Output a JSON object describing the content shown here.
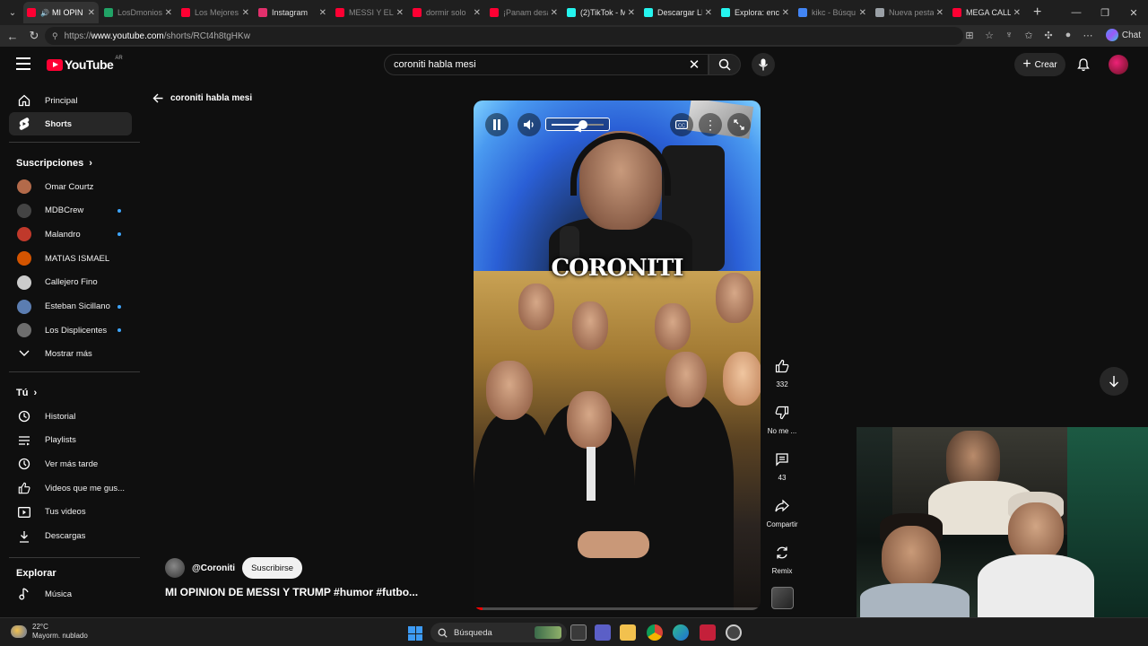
{
  "browser": {
    "tabs": [
      {
        "title": "MI OPIN",
        "active": true,
        "color": "#ff0033",
        "sound": true
      },
      {
        "title": "LosDmonios",
        "color": "#21a366"
      },
      {
        "title": "Los Mejores",
        "color": "#ff0033"
      },
      {
        "title": "Instagram",
        "color": "#e1306c",
        "lit": true
      },
      {
        "title": "MESSI Y EL",
        "color": "#ff0033"
      },
      {
        "title": "dormir solo",
        "color": "#ff0033"
      },
      {
        "title": "¡Panam desa",
        "color": "#ff0033"
      },
      {
        "title": "(2)TikTok - M",
        "color": "#25f4ee",
        "lit": true
      },
      {
        "title": "Descargar LIV",
        "color": "#25f4ee",
        "lit": true
      },
      {
        "title": "Explora: encu",
        "color": "#25f4ee",
        "lit": true
      },
      {
        "title": "kikc - Búsqu",
        "color": "#4285f4"
      },
      {
        "title": "Nueva pesta",
        "color": "#9aa0a6"
      },
      {
        "title": "MEGA CALLE",
        "color": "#ff0033",
        "lit": true
      }
    ],
    "url_prefix": "https://",
    "url_host": "www.youtube.com",
    "url_path": "/shorts/RCt4h8tgHKw",
    "chat_label": "Chat"
  },
  "header": {
    "logo_text": "YouTube",
    "country_code": "AR",
    "search_value": "coroniti habla mesi",
    "create_label": "Crear"
  },
  "sidebar": {
    "main": [
      {
        "label": "Principal",
        "icon": "home-icon"
      },
      {
        "label": "Shorts",
        "icon": "shorts-icon",
        "selected": true
      }
    ],
    "subscriptions_title": "Suscripciones",
    "subscriptions": [
      {
        "label": "Omar Courtz",
        "color": "#b36a4a"
      },
      {
        "label": "MDBCrew",
        "color": "#444444",
        "dot": true
      },
      {
        "label": "Malandro",
        "color": "#c0392b",
        "dot": true
      },
      {
        "label": "MATIAS ISMAEL",
        "color": "#d35400"
      },
      {
        "label": "Callejero Fino",
        "color": "#cccccc"
      },
      {
        "label": "Esteban Sicillano",
        "color": "#5b7db1",
        "dot": true
      },
      {
        "label": "Los Displicentes",
        "color": "#6d6d6d",
        "dot": true
      }
    ],
    "show_more": "Mostrar más",
    "you_title": "Tú",
    "you": [
      {
        "label": "Historial",
        "icon": "history-icon"
      },
      {
        "label": "Playlists",
        "icon": "playlists-icon"
      },
      {
        "label": "Ver más tarde",
        "icon": "watch-later-icon"
      },
      {
        "label": "Videos que me gus...",
        "icon": "like-icon"
      },
      {
        "label": "Tus videos",
        "icon": "your-videos-icon"
      },
      {
        "label": "Descargas",
        "icon": "download-icon"
      }
    ],
    "explore_title": "Explorar",
    "explore": [
      {
        "label": "Música",
        "icon": "music-icon"
      }
    ]
  },
  "short": {
    "query": "coroniti habla mesi",
    "overlay_title": "CORONITI",
    "volume_level": 0.6,
    "progress": 0.03,
    "channel": "@Coroniti",
    "subscribe_label": "Suscribirse",
    "title": "MI OPINION DE MESSI Y TRUMP #humor #futbo..."
  },
  "actions": {
    "like_count": "332",
    "dislike_label": "No me ...",
    "comments_count": "43",
    "share_label": "Compartir",
    "remix_label": "Remix"
  },
  "taskbar": {
    "temp": "22°C",
    "weather": "Mayorm. nublado",
    "search_label": "Búsqueda"
  },
  "colors": {
    "accent": "#ff0033",
    "background": "#0f0f0f",
    "selected": "#272727",
    "link_dot": "#3ea6ff"
  }
}
